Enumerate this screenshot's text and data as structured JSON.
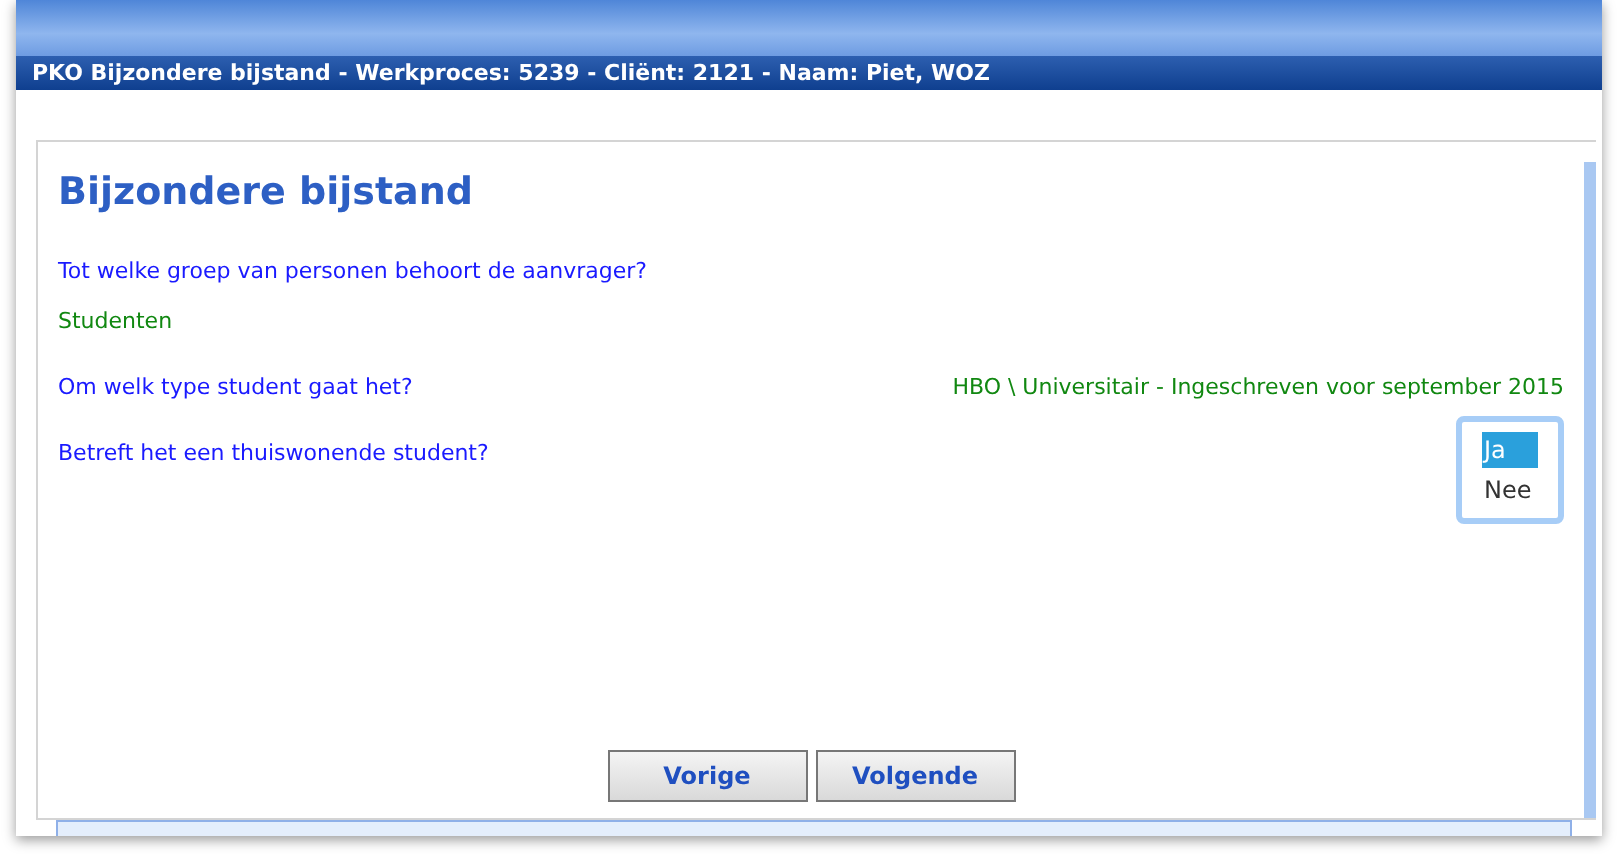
{
  "title_bar": "PKO Bijzondere bijstand - Werkproces: 5239 - Cliënt: 2121 - Naam: Piet, WOZ",
  "heading": "Bijzondere bijstand",
  "questions": [
    {
      "kind": "stacked",
      "question": "Tot welke groep van personen behoort de aanvrager?",
      "answer": "Studenten"
    },
    {
      "kind": "inline",
      "question": "Om welk type student gaat het?",
      "answer": "HBO \\ Universitair - Ingeschreven voor september 2015"
    },
    {
      "kind": "choice",
      "question": "Betreft het een thuiswonende student?",
      "options": [
        {
          "label": "Ja",
          "selected": true
        },
        {
          "label": "Nee",
          "selected": false
        }
      ]
    }
  ],
  "buttons": [
    "Vorige",
    "Volgende"
  ]
}
